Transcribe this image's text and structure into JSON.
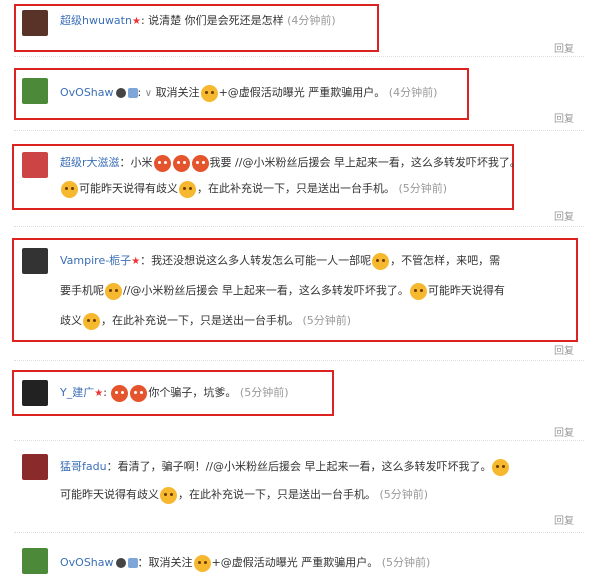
{
  "comments": [
    {
      "user": "超级hwuwatn",
      "text": "说清楚 你们是会死还是怎样",
      "time": "(4分钟前)",
      "reply": "回复"
    },
    {
      "user": "OvOShaw",
      "text_a": "取消关注",
      "text_b": "+@虚假活动曝光 严重欺骗用户。",
      "time": "(4分钟前)",
      "reply": "回复"
    },
    {
      "user": "超级r大滋滋",
      "text_a": "：小米",
      "text_b": "我要 //@小米粉丝后援会 早上起来一看，这么多转发吓坏我了。",
      "text_c": "可能昨天说得有歧义",
      "text_d": "，在此补充说一下，只是送出一台手机。",
      "time": "(5分钟前)",
      "reply": "回复"
    },
    {
      "user": "Vampire-栀子",
      "text_a": "：我还没想说这么多人转发怎么可能一人一部呢",
      "text_b": "，不管怎样，来吧，需",
      "text_c": "要手机呢",
      "text_d": "//@小米粉丝后援会 早上起来一看，这么多转发吓坏我了。",
      "text_e": "可能昨天说得有",
      "text_f": "歧义",
      "text_g": "，在此补充说一下，只是送出一台手机。",
      "time": "(5分钟前)",
      "reply": "回复"
    },
    {
      "user": "Y_建广",
      "text": "你个骗子，坑爹。",
      "time": "(5分钟前)",
      "reply": "回复"
    },
    {
      "user": "猛哥fadu",
      "text_a": "：看清了，骗子啊！//@小米粉丝后援会 早上起来一看，这么多转发吓坏我了。",
      "text_b": "可能昨天说得有歧义",
      "text_c": "，在此补充说一下，只是送出一台手机。",
      "time": "(5分钟前)",
      "reply": "回复"
    },
    {
      "user": "OvOShaw",
      "text_a": "：取消关注",
      "text_b": "+@虚假活动曝光 严重欺骗用户。",
      "time": "(5分钟前)"
    }
  ],
  "colors": {
    "highlight": "#d22222",
    "link": "#3b6fb6",
    "muted": "#999999"
  }
}
